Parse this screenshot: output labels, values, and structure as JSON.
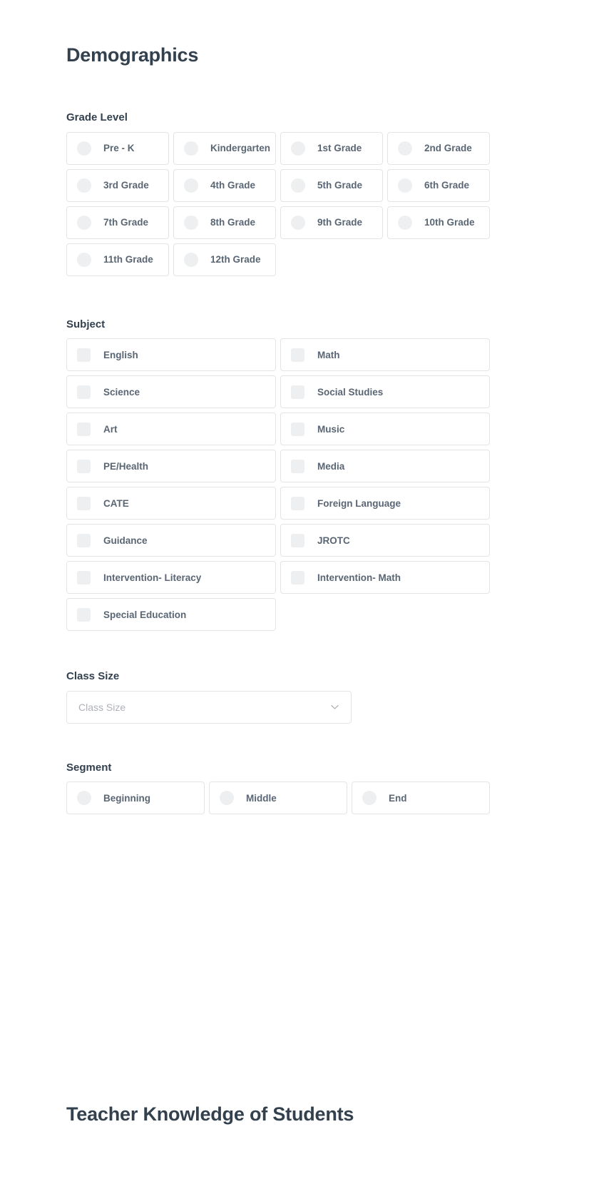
{
  "page": {
    "title": "Demographics",
    "bottom_title": "Teacher Knowledge of Students",
    "colors": {
      "heading": "#33414f",
      "label": "#5a6673",
      "border": "#e2e4e6",
      "control_fill": "#eeeff0",
      "placeholder": "#aeb2b8",
      "background": "#ffffff"
    }
  },
  "sections": {
    "grade_level": {
      "title": "Grade Level",
      "control": "radio",
      "columns": 4,
      "options": [
        {
          "label": "Pre - K",
          "selected": false
        },
        {
          "label": "Kindergarten",
          "selected": false
        },
        {
          "label": "1st Grade",
          "selected": false
        },
        {
          "label": "2nd Grade",
          "selected": false
        },
        {
          "label": "3rd Grade",
          "selected": false
        },
        {
          "label": "4th Grade",
          "selected": false
        },
        {
          "label": "5th Grade",
          "selected": false
        },
        {
          "label": "6th Grade",
          "selected": false
        },
        {
          "label": "7th Grade",
          "selected": false
        },
        {
          "label": "8th Grade",
          "selected": false
        },
        {
          "label": "9th Grade",
          "selected": false
        },
        {
          "label": "10th Grade",
          "selected": false
        },
        {
          "label": "11th Grade",
          "selected": false
        },
        {
          "label": "12th Grade",
          "selected": false
        }
      ]
    },
    "subject": {
      "title": "Subject",
      "control": "checkbox",
      "columns": 2,
      "options": [
        {
          "label": "English",
          "selected": false
        },
        {
          "label": "Math",
          "selected": false
        },
        {
          "label": "Science",
          "selected": false
        },
        {
          "label": "Social Studies",
          "selected": false
        },
        {
          "label": "Art",
          "selected": false
        },
        {
          "label": "Music",
          "selected": false
        },
        {
          "label": "PE/Health",
          "selected": false
        },
        {
          "label": "Media",
          "selected": false
        },
        {
          "label": "CATE",
          "selected": false
        },
        {
          "label": "Foreign Language",
          "selected": false
        },
        {
          "label": "Guidance",
          "selected": false
        },
        {
          "label": "JROTC",
          "selected": false
        },
        {
          "label": "Intervention- Literacy",
          "selected": false
        },
        {
          "label": "Intervention- Math",
          "selected": false
        },
        {
          "label": "Special Education",
          "selected": false
        }
      ]
    },
    "class_size": {
      "title": "Class Size",
      "control": "select",
      "placeholder": "Class Size",
      "value": "",
      "icon": "chevron-down-icon"
    },
    "segment": {
      "title": "Segment",
      "control": "radio",
      "columns": 3,
      "options": [
        {
          "label": "Beginning",
          "selected": false
        },
        {
          "label": "Middle",
          "selected": false
        },
        {
          "label": "End",
          "selected": false
        }
      ]
    }
  }
}
